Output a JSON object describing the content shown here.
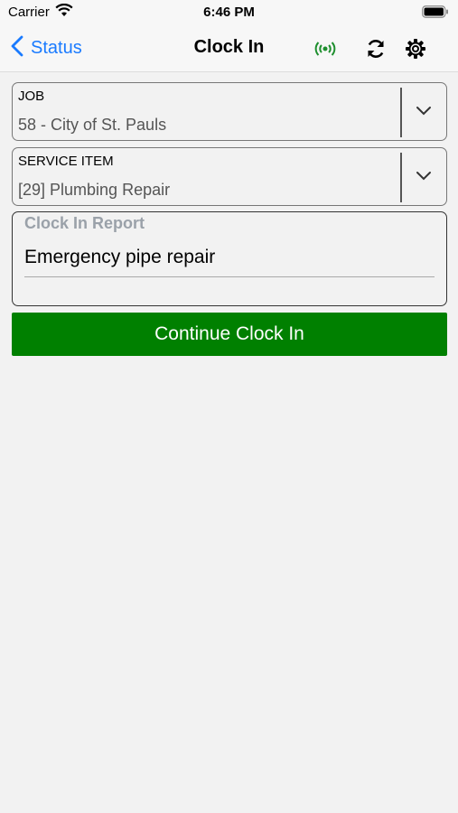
{
  "status_bar": {
    "carrier": "Carrier",
    "time": "6:46 PM"
  },
  "nav": {
    "back_label": "Status",
    "title": "Clock In",
    "icons": [
      "signal-icon",
      "refresh-icon",
      "gear-icon"
    ],
    "back_color": "#1a7bff",
    "signal_color": "#1e8f2e"
  },
  "job": {
    "label": "JOB",
    "value": "58 - City of St. Pauls"
  },
  "service_item": {
    "label": "SERVICE ITEM",
    "value": "[29] Plumbing Repair"
  },
  "report": {
    "label": "Clock In Report",
    "value": "Emergency pipe repair"
  },
  "continue_button": {
    "label": "Continue Clock In",
    "color": "#008000"
  }
}
